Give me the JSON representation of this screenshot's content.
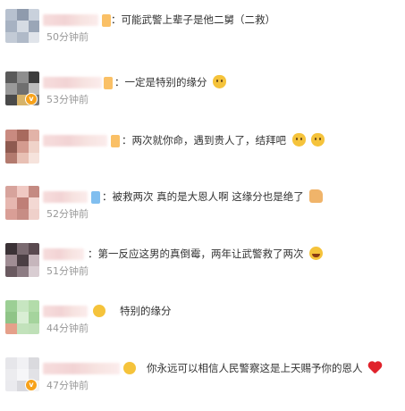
{
  "comments": [
    {
      "text": "：可能武警上辈子是他二舅（二救）",
      "time": "50分钟前",
      "emojis": [],
      "avatar_colors": [
        "#b7c1cf",
        "#8f9bad",
        "#c9d1dc",
        "#a7b2c2",
        "#d5dbe3",
        "#9aa6b7",
        "#c3cbd6",
        "#b0bac8",
        "#e0e4ea"
      ],
      "vbadge": ""
    },
    {
      "text": "：一定是特别的缘分",
      "time": "53分钟前",
      "emojis": [
        "cat-emoji"
      ],
      "avatar_colors": [
        "#5a5a5a",
        "#8e8e8e",
        "#3d3d3d",
        "#9a9a9a",
        "#6f6f6f",
        "#bdbdbd",
        "#4a4a4a",
        "#d6b36a",
        "#7a7a7a"
      ],
      "vbadge": "v"
    },
    {
      "text": "：两次就你命，遇到贵人了，结拜吧",
      "time": "",
      "emojis": [
        "cat-emoji",
        "cat-emoji"
      ],
      "avatar_colors": [
        "#c98a80",
        "#a86a5e",
        "#e2b3a8",
        "#8f5a50",
        "#d49b8f",
        "#f0d3c9",
        "#b37a6e",
        "#e8c0b4",
        "#f6e3dc"
      ],
      "vbadge": ""
    },
    {
      "text": "：被救两次 真的是大恩人啊 这缘分也是绝了",
      "time": "52分钟前",
      "emojis": [
        "thumbs-up-emoji"
      ],
      "avatar_colors": [
        "#d7a39c",
        "#f0c9c3",
        "#c48a82",
        "#e6b7b0",
        "#bf7f77",
        "#f3d8d3",
        "#d99e96",
        "#c78d85",
        "#efd0ca"
      ],
      "vbadge": ""
    },
    {
      "text": "：第一反应这男的真倒霉，两年让武警救了两次",
      "time": "51分钟前",
      "emojis": [
        "laughing-emoji"
      ],
      "avatar_colors": [
        "#3b3236",
        "#7a6a70",
        "#5a4a50",
        "#a08d94",
        "#4b3f44",
        "#c6b6bc",
        "#6a5a60",
        "#8d7c83",
        "#d9cdd2"
      ],
      "vbadge": ""
    },
    {
      "text": "特别的缘分",
      "time": "44分钟前",
      "emojis": [],
      "avatar_colors": [
        "#9ccf95",
        "#c7e6c1",
        "#b3dcaa",
        "#8fc487",
        "#d9eed4",
        "#a5d49d",
        "#e5a08a",
        "#c2e2bb",
        "#bfe0b8"
      ],
      "vbadge": ""
    },
    {
      "text": "你永远可以相信人民警察这是上天赐予你的恩人",
      "time": "47分钟前",
      "emojis": [
        "heart-emoji"
      ],
      "avatar_colors": [
        "#e6e6ea",
        "#f1f1f4",
        "#dadade",
        "#ececef",
        "#f6f6f8",
        "#e2e2e6",
        "#eaeaee",
        "#d9d9de",
        "#f3f3f5"
      ],
      "vbadge": "v"
    }
  ],
  "colors": {
    "text": "#333333",
    "time": "#999999",
    "vbadge_orange": "#f7a21b"
  }
}
